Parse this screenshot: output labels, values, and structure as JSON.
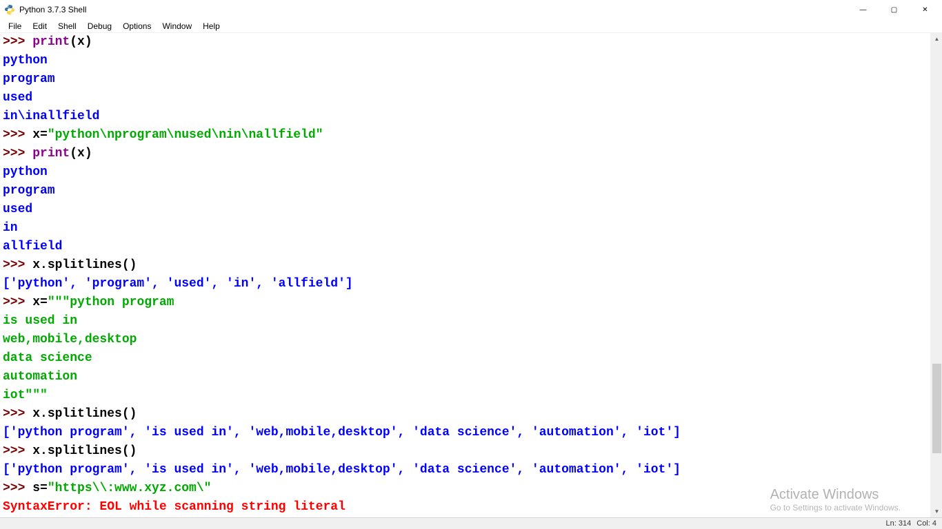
{
  "window": {
    "title": "Python 3.7.3 Shell",
    "controls": {
      "min": "🗕",
      "max": "🗖",
      "close": "✕"
    }
  },
  "menu": [
    "File",
    "Edit",
    "Shell",
    "Debug",
    "Options",
    "Window",
    "Help"
  ],
  "status": {
    "ln": "Ln: 314",
    "col": "Col: 4"
  },
  "watermark": {
    "title": "Activate Windows",
    "sub": "Go to Settings to activate Windows."
  },
  "lines": [
    {
      "segs": [
        {
          "c": "prompt",
          "t": ">>> "
        },
        {
          "c": "builtin",
          "t": "print"
        },
        {
          "c": "norm",
          "t": "(x)"
        }
      ]
    },
    {
      "segs": [
        {
          "c": "stdout",
          "t": "python"
        }
      ]
    },
    {
      "segs": [
        {
          "c": "stdout",
          "t": "program"
        }
      ]
    },
    {
      "segs": [
        {
          "c": "stdout",
          "t": "used"
        }
      ]
    },
    {
      "segs": [
        {
          "c": "stdout",
          "t": "in\\inallfield"
        }
      ]
    },
    {
      "segs": [
        {
          "c": "prompt",
          "t": ">>> "
        },
        {
          "c": "norm",
          "t": "x="
        },
        {
          "c": "str",
          "t": "\"python\\nprogram\\nused\\nin\\nallfield\""
        }
      ]
    },
    {
      "segs": [
        {
          "c": "prompt",
          "t": ">>> "
        },
        {
          "c": "builtin",
          "t": "print"
        },
        {
          "c": "norm",
          "t": "(x)"
        }
      ]
    },
    {
      "segs": [
        {
          "c": "stdout",
          "t": "python"
        }
      ]
    },
    {
      "segs": [
        {
          "c": "stdout",
          "t": "program"
        }
      ]
    },
    {
      "segs": [
        {
          "c": "stdout",
          "t": "used"
        }
      ]
    },
    {
      "segs": [
        {
          "c": "stdout",
          "t": "in"
        }
      ]
    },
    {
      "segs": [
        {
          "c": "stdout",
          "t": "allfield"
        }
      ]
    },
    {
      "segs": [
        {
          "c": "prompt",
          "t": ">>> "
        },
        {
          "c": "norm",
          "t": "x.splitlines()"
        }
      ]
    },
    {
      "segs": [
        {
          "c": "stdout",
          "t": "['python', 'program', 'used', 'in', 'allfield']"
        }
      ]
    },
    {
      "segs": [
        {
          "c": "prompt",
          "t": ">>> "
        },
        {
          "c": "norm",
          "t": "x="
        },
        {
          "c": "str",
          "t": "\"\"\"python program"
        }
      ]
    },
    {
      "segs": [
        {
          "c": "str",
          "t": "is used in"
        }
      ]
    },
    {
      "segs": [
        {
          "c": "str",
          "t": "web,mobile,desktop"
        }
      ]
    },
    {
      "segs": [
        {
          "c": "str",
          "t": "data science"
        }
      ]
    },
    {
      "segs": [
        {
          "c": "str",
          "t": "automation"
        }
      ]
    },
    {
      "segs": [
        {
          "c": "str",
          "t": "iot\"\"\""
        }
      ]
    },
    {
      "segs": [
        {
          "c": "prompt",
          "t": ">>> "
        },
        {
          "c": "norm",
          "t": "x.splitlines()"
        }
      ]
    },
    {
      "segs": [
        {
          "c": "stdout",
          "t": "['python program', 'is used in', 'web,mobile,desktop', 'data science', 'automation', 'iot']"
        }
      ]
    },
    {
      "segs": [
        {
          "c": "prompt",
          "t": ">>> "
        },
        {
          "c": "norm",
          "t": "x.splitlines()"
        }
      ]
    },
    {
      "segs": [
        {
          "c": "stdout",
          "t": "['python program', 'is used in', 'web,mobile,desktop', 'data science', 'automation', 'iot']"
        }
      ]
    },
    {
      "segs": [
        {
          "c": "prompt",
          "t": ">>> "
        },
        {
          "c": "norm",
          "t": "s="
        },
        {
          "c": "str",
          "t": "\"https\\\\:www.xyz.com\\\""
        }
      ]
    },
    {
      "segs": [
        {
          "c": "err",
          "t": "SyntaxError: EOL while scanning string literal"
        }
      ]
    }
  ]
}
